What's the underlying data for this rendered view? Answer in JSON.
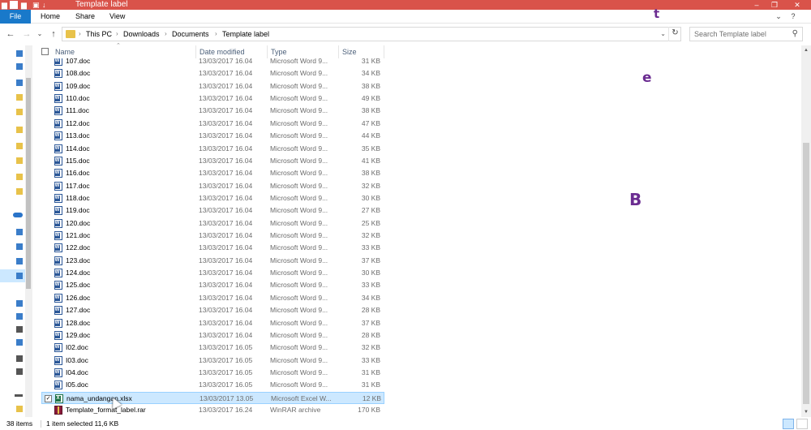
{
  "window": {
    "title": "Template label",
    "controls": {
      "minimize": "–",
      "restore": "❐",
      "close": "✕"
    }
  },
  "quick_access": {
    "pin": "↓"
  },
  "ribbon": {
    "tabs": [
      {
        "label": "File",
        "active": true
      },
      {
        "label": "Home"
      },
      {
        "label": "Share"
      },
      {
        "label": "View"
      }
    ],
    "expand_icon": "⌄",
    "help_icon": "?"
  },
  "address": {
    "back": "←",
    "forward": "→",
    "recent": "⌄",
    "up": "↑",
    "breadcrumb": [
      "This PC",
      "Downloads",
      "Documents",
      "Template label"
    ],
    "dropdown": "⌄",
    "refresh": "↻",
    "search_placeholder": "Search Template label",
    "search_icon": "⚲"
  },
  "columns": {
    "name": "Name",
    "date": "Date modified",
    "type": "Type",
    "size": "Size"
  },
  "files": [
    {
      "name": "107.doc",
      "date": "13/03/2017 16.04",
      "type": "Microsoft Word 9...",
      "size": "31 KB",
      "icon": "doc",
      "partial": true
    },
    {
      "name": "108.doc",
      "date": "13/03/2017 16.04",
      "type": "Microsoft Word 9...",
      "size": "34 KB",
      "icon": "doc"
    },
    {
      "name": "109.doc",
      "date": "13/03/2017 16.04",
      "type": "Microsoft Word 9...",
      "size": "38 KB",
      "icon": "doc"
    },
    {
      "name": "110.doc",
      "date": "13/03/2017 16.04",
      "type": "Microsoft Word 9...",
      "size": "49 KB",
      "icon": "doc"
    },
    {
      "name": "111.doc",
      "date": "13/03/2017 16.04",
      "type": "Microsoft Word 9...",
      "size": "38 KB",
      "icon": "doc"
    },
    {
      "name": "112.doc",
      "date": "13/03/2017 16.04",
      "type": "Microsoft Word 9...",
      "size": "47 KB",
      "icon": "doc"
    },
    {
      "name": "113.doc",
      "date": "13/03/2017 16.04",
      "type": "Microsoft Word 9...",
      "size": "44 KB",
      "icon": "doc"
    },
    {
      "name": "114.doc",
      "date": "13/03/2017 16.04",
      "type": "Microsoft Word 9...",
      "size": "35 KB",
      "icon": "doc"
    },
    {
      "name": "115.doc",
      "date": "13/03/2017 16.04",
      "type": "Microsoft Word 9...",
      "size": "41 KB",
      "icon": "doc"
    },
    {
      "name": "116.doc",
      "date": "13/03/2017 16.04",
      "type": "Microsoft Word 9...",
      "size": "38 KB",
      "icon": "doc"
    },
    {
      "name": "117.doc",
      "date": "13/03/2017 16.04",
      "type": "Microsoft Word 9...",
      "size": "32 KB",
      "icon": "doc"
    },
    {
      "name": "118.doc",
      "date": "13/03/2017 16.04",
      "type": "Microsoft Word 9...",
      "size": "30 KB",
      "icon": "doc"
    },
    {
      "name": "119.doc",
      "date": "13/03/2017 16.04",
      "type": "Microsoft Word 9...",
      "size": "27 KB",
      "icon": "doc"
    },
    {
      "name": "120.doc",
      "date": "13/03/2017 16.04",
      "type": "Microsoft Word 9...",
      "size": "25 KB",
      "icon": "doc"
    },
    {
      "name": "121.doc",
      "date": "13/03/2017 16.04",
      "type": "Microsoft Word 9...",
      "size": "32 KB",
      "icon": "doc"
    },
    {
      "name": "122.doc",
      "date": "13/03/2017 16.04",
      "type": "Microsoft Word 9...",
      "size": "33 KB",
      "icon": "doc"
    },
    {
      "name": "123.doc",
      "date": "13/03/2017 16.04",
      "type": "Microsoft Word 9...",
      "size": "37 KB",
      "icon": "doc"
    },
    {
      "name": "124.doc",
      "date": "13/03/2017 16.04",
      "type": "Microsoft Word 9...",
      "size": "30 KB",
      "icon": "doc"
    },
    {
      "name": "125.doc",
      "date": "13/03/2017 16.04",
      "type": "Microsoft Word 9...",
      "size": "33 KB",
      "icon": "doc"
    },
    {
      "name": "126.doc",
      "date": "13/03/2017 16.04",
      "type": "Microsoft Word 9...",
      "size": "34 KB",
      "icon": "doc"
    },
    {
      "name": "127.doc",
      "date": "13/03/2017 16.04",
      "type": "Microsoft Word 9...",
      "size": "28 KB",
      "icon": "doc"
    },
    {
      "name": "128.doc",
      "date": "13/03/2017 16.04",
      "type": "Microsoft Word 9...",
      "size": "37 KB",
      "icon": "doc"
    },
    {
      "name": "129.doc",
      "date": "13/03/2017 16.04",
      "type": "Microsoft Word 9...",
      "size": "28 KB",
      "icon": "doc"
    },
    {
      "name": "I02.doc",
      "date": "13/03/2017 16.05",
      "type": "Microsoft Word 9...",
      "size": "32 KB",
      "icon": "doc"
    },
    {
      "name": "I03.doc",
      "date": "13/03/2017 16.05",
      "type": "Microsoft Word 9...",
      "size": "33 KB",
      "icon": "doc"
    },
    {
      "name": "I04.doc",
      "date": "13/03/2017 16.05",
      "type": "Microsoft Word 9...",
      "size": "31 KB",
      "icon": "doc"
    },
    {
      "name": "I05.doc",
      "date": "13/03/2017 16.05",
      "type": "Microsoft Word 9...",
      "size": "31 KB",
      "icon": "doc"
    },
    {
      "name": "nama_undangan.xlsx",
      "date": "13/03/2017 13.05",
      "type": "Microsoft Excel W...",
      "size": "12 KB",
      "icon": "xls",
      "selected": true
    },
    {
      "name": "Template_format_label.rar",
      "date": "13/03/2017 16.24",
      "type": "WinRAR archive",
      "size": "170 KB",
      "icon": "rar"
    }
  ],
  "overlay_letters": [
    "t",
    "e",
    "B"
  ],
  "status": {
    "item_count": "38 items",
    "selection": "1 item selected  11,6 KB"
  },
  "colors": {
    "titlebar": "#d9534a",
    "file_tab": "#1979ca",
    "selection": "#cce8ff",
    "overlay_letter": "#6b2c91"
  }
}
